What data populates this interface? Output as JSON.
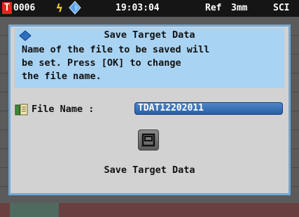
{
  "status_bar": {
    "t_badge": "T",
    "sample_number": "0006",
    "time": "19:03:04",
    "ref": "Ref",
    "aperture": "3mm",
    "mode": "SCI"
  },
  "dialog": {
    "title": "Save Target Data",
    "message": "Name of the file to be saved will\nbe set. Press [OK] to change\nthe file name.",
    "file_name_label": "File Name :",
    "file_name_value": "TDAT12202011",
    "button_label": "Save Target Data"
  },
  "colors": {
    "accent_header": "#a9d3f2",
    "dialog_border": "#6fa9d9",
    "input_fill": "#2c5fa6",
    "badge_red": "#e8251d"
  },
  "icons": [
    "bolt-icon",
    "diamond-icon",
    "file-icon",
    "save-icon"
  ]
}
